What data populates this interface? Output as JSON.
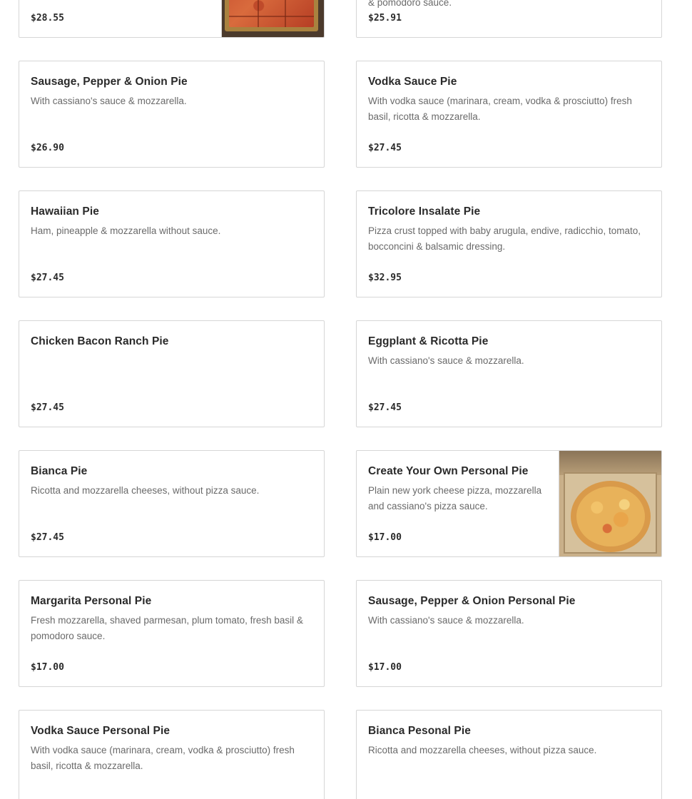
{
  "menu": {
    "items": [
      {
        "name": "",
        "description": "",
        "price": "$28.55",
        "photo": "sicilian-square-pie-photo"
      },
      {
        "name": "",
        "description": "& pomodoro sauce.",
        "price": "$25.91"
      },
      {
        "name": "Sausage, Pepper & Onion Pie",
        "description": "With cassiano's sauce & mozzarella.",
        "price": "$26.90"
      },
      {
        "name": "Vodka Sauce Pie",
        "description": "With vodka sauce (marinara, cream, vodka & prosciutto) fresh basil, ricotta & mozzarella.",
        "price": "$27.45"
      },
      {
        "name": "Hawaiian Pie",
        "description": "Ham, pineapple & mozzarella without sauce.",
        "price": "$27.45"
      },
      {
        "name": "Tricolore Insalate Pie",
        "description": "Pizza crust topped with baby arugula, endive, radicchio, tomato, bocconcini & balsamic dressing.",
        "price": "$32.95"
      },
      {
        "name": "Chicken Bacon Ranch Pie",
        "description": "",
        "price": "$27.45"
      },
      {
        "name": "Eggplant & Ricotta Pie",
        "description": "With cassiano's sauce & mozzarella.",
        "price": "$27.45"
      },
      {
        "name": "Bianca Pie",
        "description": "Ricotta and mozzarella cheeses, without pizza sauce.",
        "price": "$27.45"
      },
      {
        "name": "Create Your Own Personal Pie",
        "description": "Plain new york cheese pizza, mozzarella and cassiano's pizza sauce.",
        "price": "$17.00",
        "photo": "personal-pie-in-box-photo"
      },
      {
        "name": "Margarita Personal Pie",
        "description": "Fresh mozzarella, shaved parmesan, plum tomato, fresh basil & pomodoro sauce.",
        "price": "$17.00"
      },
      {
        "name": "Sausage, Pepper & Onion Personal Pie",
        "description": "With cassiano's sauce & mozzarella.",
        "price": "$17.00"
      },
      {
        "name": "Vodka Sauce Personal Pie",
        "description": "With vodka sauce (marinara, cream, vodka & prosciutto) fresh basil, ricotta & mozzarella.",
        "price": ""
      },
      {
        "name": "Bianca Pesonal Pie",
        "description": "Ricotta and mozzarella cheeses, without pizza sauce.",
        "price": ""
      }
    ]
  },
  "colors": {
    "card_border": "#d6d6d6",
    "title_text": "#2a2a2a",
    "description_text": "#6a6a6a",
    "background": "#ffffff"
  }
}
